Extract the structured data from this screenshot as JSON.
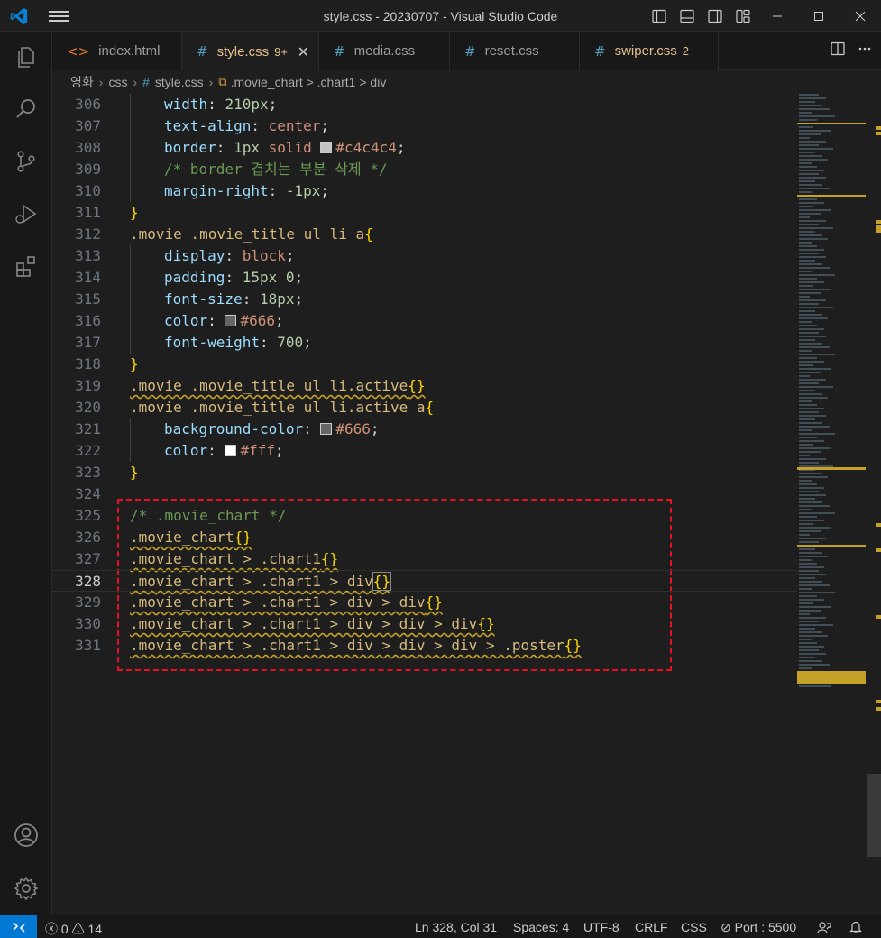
{
  "window": {
    "title": "style.css - 20230707 - Visual Studio Code"
  },
  "tabs": [
    {
      "label": "index.html",
      "icon": "<>"
    },
    {
      "label": "style.css",
      "icon": "#",
      "badge": "9+"
    },
    {
      "label": "media.css",
      "icon": "#"
    },
    {
      "label": "reset.css",
      "icon": "#"
    },
    {
      "label": "swiper.css",
      "icon": "#",
      "badge": "2"
    }
  ],
  "breadcrumb": {
    "folder": "영화",
    "subfolder": "css",
    "file": "style.css",
    "symbol": ".movie_chart > .chart1 > div"
  },
  "editor": {
    "lines": [
      {
        "num": "306",
        "indent": 1,
        "segs": [
          [
            "p",
            "width"
          ],
          [
            "w",
            ": "
          ],
          [
            "n",
            "210px"
          ],
          [
            "w",
            ";"
          ]
        ]
      },
      {
        "num": "307",
        "indent": 1,
        "segs": [
          [
            "p",
            "text-align"
          ],
          [
            "w",
            ": "
          ],
          [
            "v",
            "center"
          ],
          [
            "w",
            ";"
          ]
        ]
      },
      {
        "num": "308",
        "indent": 1,
        "segs": [
          [
            "p",
            "border"
          ],
          [
            "w",
            ": "
          ],
          [
            "n",
            "1px"
          ],
          [
            "w",
            " "
          ],
          [
            "v",
            "solid"
          ],
          [
            "w",
            " "
          ],
          [
            "swatch",
            "#c4c4c4"
          ],
          [
            "v",
            "#c4c4c4"
          ],
          [
            "w",
            ";"
          ]
        ]
      },
      {
        "num": "309",
        "indent": 1,
        "segs": [
          [
            "cm",
            "/* border 겹치는 부분 삭제 */"
          ]
        ]
      },
      {
        "num": "310",
        "indent": 1,
        "segs": [
          [
            "p",
            "margin-right"
          ],
          [
            "w",
            ": "
          ],
          [
            "n",
            "-1px"
          ],
          [
            "w",
            ";"
          ]
        ]
      },
      {
        "num": "311",
        "indent": 0,
        "segs": [
          [
            "br",
            "}"
          ]
        ]
      },
      {
        "num": "312",
        "indent": 0,
        "segs": [
          [
            "sel",
            ".movie .movie_title ul li a"
          ],
          [
            "br",
            "{"
          ]
        ]
      },
      {
        "num": "313",
        "indent": 1,
        "segs": [
          [
            "p",
            "display"
          ],
          [
            "w",
            ": "
          ],
          [
            "v",
            "block"
          ],
          [
            "w",
            ";"
          ]
        ]
      },
      {
        "num": "314",
        "indent": 1,
        "segs": [
          [
            "p",
            "padding"
          ],
          [
            "w",
            ": "
          ],
          [
            "n",
            "15px 0"
          ],
          [
            "w",
            ";"
          ]
        ]
      },
      {
        "num": "315",
        "indent": 1,
        "segs": [
          [
            "p",
            "font-size"
          ],
          [
            "w",
            ": "
          ],
          [
            "n",
            "18px"
          ],
          [
            "w",
            ";"
          ]
        ]
      },
      {
        "num": "316",
        "indent": 1,
        "segs": [
          [
            "p",
            "color"
          ],
          [
            "w",
            ": "
          ],
          [
            "swatch",
            "#666666"
          ],
          [
            "v",
            "#666"
          ],
          [
            "w",
            ";"
          ]
        ]
      },
      {
        "num": "317",
        "indent": 1,
        "segs": [
          [
            "p",
            "font-weight"
          ],
          [
            "w",
            ": "
          ],
          [
            "n",
            "700"
          ],
          [
            "w",
            ";"
          ]
        ]
      },
      {
        "num": "318",
        "indent": 0,
        "segs": [
          [
            "br",
            "}"
          ]
        ]
      },
      {
        "num": "319",
        "indent": 0,
        "segs": [
          [
            "sel wv",
            ".movie .movie_title ul li.active"
          ],
          [
            "br wv",
            "{}"
          ]
        ]
      },
      {
        "num": "320",
        "indent": 0,
        "segs": [
          [
            "sel",
            ".movie .movie_title ul li.active a"
          ],
          [
            "br",
            "{"
          ]
        ]
      },
      {
        "num": "321",
        "indent": 1,
        "segs": [
          [
            "p",
            "background-color"
          ],
          [
            "w",
            ": "
          ],
          [
            "swatch",
            "#666666"
          ],
          [
            "v",
            "#666"
          ],
          [
            "w",
            ";"
          ]
        ]
      },
      {
        "num": "322",
        "indent": 1,
        "segs": [
          [
            "p",
            "color"
          ],
          [
            "w",
            ": "
          ],
          [
            "swatch",
            "#ffffff"
          ],
          [
            "v",
            "#fff"
          ],
          [
            "w",
            ";"
          ]
        ]
      },
      {
        "num": "323",
        "indent": 0,
        "segs": [
          [
            "br",
            "}"
          ]
        ]
      },
      {
        "num": "324",
        "indent": 0,
        "segs": []
      },
      {
        "num": "325",
        "indent": 0,
        "segs": [
          [
            "cm",
            "/* .movie_chart */"
          ]
        ]
      },
      {
        "num": "326",
        "indent": 0,
        "segs": [
          [
            "sel wv",
            ".movie_chart"
          ],
          [
            "br wv",
            "{}"
          ]
        ]
      },
      {
        "num": "327",
        "indent": 0,
        "segs": [
          [
            "sel wv",
            ".movie_chart > .chart1"
          ],
          [
            "br wv",
            "{}"
          ]
        ]
      },
      {
        "num": "328",
        "indent": 0,
        "current": true,
        "segs": [
          [
            "sel wv",
            ".movie_chart > .chart1 > div"
          ],
          [
            "br wv bracket-match",
            "{}"
          ]
        ]
      },
      {
        "num": "329",
        "indent": 0,
        "segs": [
          [
            "sel wv",
            ".movie_chart > .chart1 > div > div"
          ],
          [
            "br wv",
            "{}"
          ]
        ]
      },
      {
        "num": "330",
        "indent": 0,
        "segs": [
          [
            "sel wv",
            ".movie_chart > .chart1 > div > div > div"
          ],
          [
            "br wv",
            "{}"
          ]
        ]
      },
      {
        "num": "331",
        "indent": 0,
        "segs": [
          [
            "sel wv",
            ".movie_chart > .chart1 > div > div > div > .poster"
          ],
          [
            "br wv",
            "{}"
          ]
        ]
      }
    ]
  },
  "statusbar": {
    "errors": "0",
    "warnings": "14",
    "position": "Ln 328, Col 31",
    "spaces": "Spaces: 4",
    "encoding": "UTF-8",
    "eol": "CRLF",
    "language": "CSS",
    "port": "Port : 5500"
  },
  "colors": {
    "accent": "#0078d4",
    "highlight_box": "#e81123",
    "warning": "#c5a128"
  }
}
